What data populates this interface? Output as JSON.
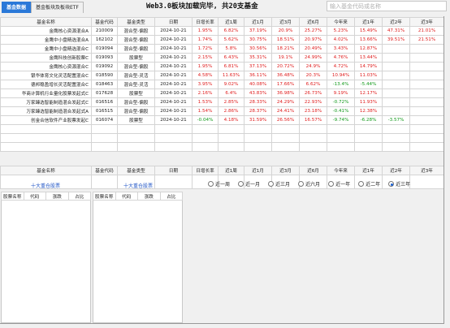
{
  "tabs": [
    "基金数据",
    "基金板块及板块ETF"
  ],
  "status_text": "Web3.0板块加载完毕, 共20支基金",
  "search": {
    "placeholder": "输入基金代码或名称",
    "value": ""
  },
  "table_columns": [
    "基金名称",
    "基金代码",
    "基金类型",
    "日期",
    "日增长率",
    "近1周",
    "近1月",
    "近3月",
    "近6月",
    "今年来",
    "近1年",
    "近2年",
    "近3年"
  ],
  "funds": [
    {
      "name": "金鹰核心资源混合A",
      "code": "210009",
      "type": "混合型-偏股",
      "date": "2024-10-21",
      "values": [
        "1.95%",
        "6.82%",
        "37.19%",
        "20.9%",
        "25.27%",
        "5.23%",
        "15.49%",
        "47.31%",
        "21.01%"
      ],
      "signs": [
        "p",
        "p",
        "p",
        "p",
        "p",
        "p",
        "p",
        "p",
        "p"
      ]
    },
    {
      "name": "金鹰中小盘精选混合A",
      "code": "162102",
      "type": "混合型-偏股",
      "date": "2024-10-21",
      "values": [
        "1.74%",
        "5.62%",
        "30.75%",
        "18.51%",
        "20.97%",
        "4.02%",
        "13.66%",
        "39.51%",
        "21.51%"
      ],
      "signs": [
        "p",
        "p",
        "p",
        "p",
        "p",
        "p",
        "p",
        "p",
        "p"
      ]
    },
    {
      "name": "金鹰中小盘精选混合C",
      "code": "019094",
      "type": "混合型-偏股",
      "date": "2024-10-21",
      "values": [
        "1.72%",
        "5.8%",
        "30.56%",
        "18.21%",
        "20.49%",
        "3.43%",
        "12.87%",
        "",
        ""
      ],
      "signs": [
        "p",
        "p",
        "p",
        "p",
        "p",
        "p",
        "p",
        "",
        ""
      ]
    },
    {
      "name": "金鹰科技创新股票C",
      "code": "019093",
      "type": "股票型",
      "date": "2024-10-21",
      "values": [
        "2.15%",
        "6.43%",
        "35.31%",
        "19.1%",
        "24.99%",
        "4.76%",
        "13.44%",
        "",
        ""
      ],
      "signs": [
        "p",
        "p",
        "p",
        "p",
        "p",
        "p",
        "p",
        "",
        ""
      ]
    },
    {
      "name": "金鹰核心资源混合C",
      "code": "019092",
      "type": "混合型-偏股",
      "date": "2024-10-21",
      "values": [
        "1.95%",
        "6.81%",
        "37.13%",
        "20.72%",
        "24.9%",
        "4.72%",
        "14.79%",
        "",
        ""
      ],
      "signs": [
        "p",
        "p",
        "p",
        "p",
        "p",
        "p",
        "p",
        "",
        ""
      ]
    },
    {
      "name": "银华体育文化灵活配置混合C",
      "code": "018590",
      "type": "混合型-灵活",
      "date": "2024-10-21",
      "values": [
        "4.58%",
        "11.63%",
        "36.11%",
        "36.48%",
        "20.3%",
        "10.94%",
        "11.03%",
        "",
        ""
      ],
      "signs": [
        "p",
        "p",
        "p",
        "p",
        "p",
        "p",
        "p",
        "",
        ""
      ]
    },
    {
      "name": "德邦稳盈增长灵活配置混合C",
      "code": "018463",
      "type": "混合型-灵活",
      "date": "2024-10-21",
      "values": [
        "3.95%",
        "9.02%",
        "40.08%",
        "17.66%",
        "6.62%",
        "-13.4%",
        "-5.44%",
        "",
        ""
      ],
      "signs": [
        "p",
        "p",
        "p",
        "p",
        "p",
        "n",
        "n",
        "",
        ""
      ]
    },
    {
      "name": "华商计算机行业量化股票发起式C",
      "code": "017628",
      "type": "股票型",
      "date": "2024-10-21",
      "values": [
        "2.16%",
        "6.4%",
        "43.83%",
        "36.98%",
        "26.73%",
        "9.19%",
        "12.17%",
        "",
        ""
      ],
      "signs": [
        "p",
        "p",
        "p",
        "p",
        "p",
        "p",
        "p",
        "",
        ""
      ]
    },
    {
      "name": "万家臻选智能制造混合发起式C",
      "code": "016516",
      "type": "混合型-偏股",
      "date": "2024-10-21",
      "values": [
        "1.53%",
        "2.85%",
        "28.33%",
        "24.29%",
        "22.93%",
        "-0.72%",
        "11.93%",
        "",
        ""
      ],
      "signs": [
        "p",
        "p",
        "p",
        "p",
        "p",
        "n",
        "p",
        "",
        ""
      ]
    },
    {
      "name": "万家臻选智能制造混合发起式A",
      "code": "016515",
      "type": "混合型-偏股",
      "date": "2024-10-21",
      "values": [
        "1.54%",
        "2.86%",
        "28.37%",
        "24.41%",
        "23.18%",
        "-0.41%",
        "12.38%",
        "",
        ""
      ],
      "signs": [
        "p",
        "p",
        "p",
        "p",
        "p",
        "n",
        "p",
        "",
        ""
      ]
    },
    {
      "name": "创金合信软件产业股票发起C",
      "code": "016074",
      "type": "股票型",
      "date": "2024-10-21",
      "values": [
        "-0.04%",
        "4.18%",
        "31.59%",
        "26.56%",
        "16.57%",
        "-9.74%",
        "-6.28%",
        "-3.57%",
        ""
      ],
      "signs": [
        "n",
        "p",
        "p",
        "p",
        "p",
        "n",
        "n",
        "n",
        ""
      ]
    }
  ],
  "holdings": [
    {
      "title": "十大重仓股票",
      "columns": [
        "股票名称",
        "代码",
        "涨跌",
        "占比"
      ]
    },
    {
      "title": "十大重仓股票",
      "columns": [
        "股票名称",
        "代码",
        "涨跌",
        "占比"
      ]
    }
  ],
  "periods": [
    "近一周",
    "近一月",
    "近三月",
    "近六月",
    "近一年",
    "近二年",
    "近三年"
  ],
  "selected_period": "近三年",
  "colors": {
    "up": "#e02020",
    "down": "#139a1c",
    "tab_active": "#2a78d8",
    "hold_title": "#2559c7"
  }
}
